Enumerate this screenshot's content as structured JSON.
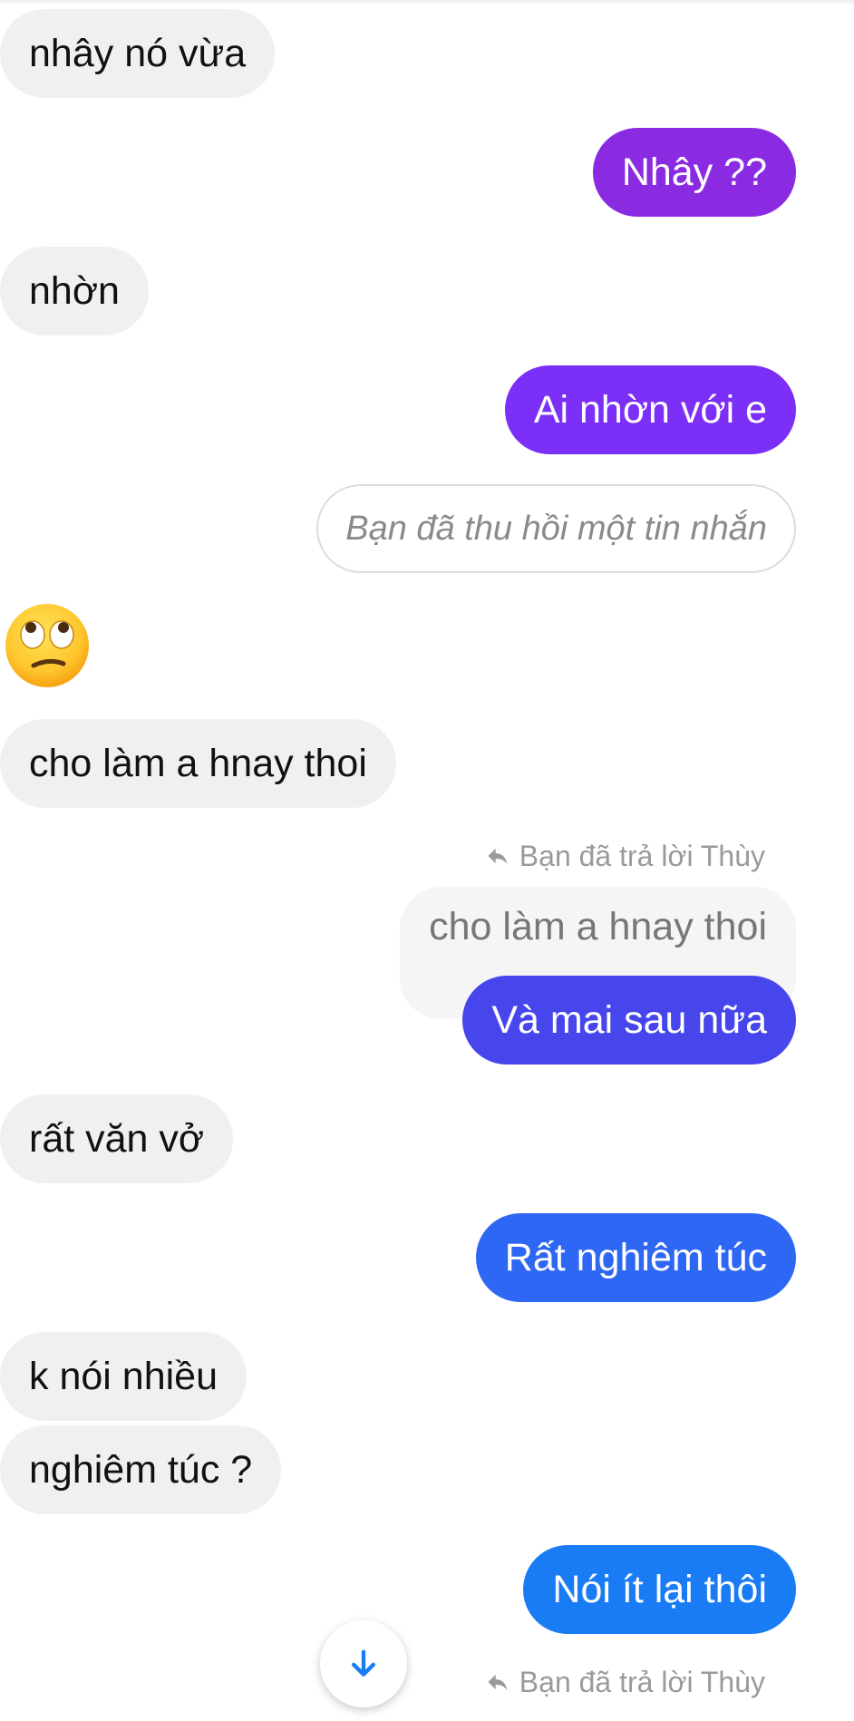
{
  "messages": {
    "m1": "nhây nó vừa",
    "m2": "Nhây ??",
    "m3": "nhờn",
    "m4": "Ai nhờn với e",
    "m5_unsent": "Bạn đã thu hồi một tin nhắn",
    "m6_emoji": "face-with-rolling-eyes",
    "m7": "cho làm a hnay thoi",
    "m8_reply_label": "Bạn đã trả lời Thùy",
    "m8_quoted": "cho làm a hnay thoi",
    "m8": "Và mai sau nữa",
    "m9": "rất văn vở",
    "m10": "Rất nghiêm túc",
    "m11": "k nói nhiều",
    "m12": "nghiêm túc ?",
    "m13": "Nói ít lại thôi",
    "m14_reply_label": "Bạn đã trả lời Thùy"
  },
  "icons": {
    "reply": "reply-arrow-icon",
    "scroll": "arrow-down-icon"
  },
  "colors": {
    "received_bg": "#f0f0f0",
    "sent_purple": "#8a2be2",
    "sent_violet": "#7b2ff7",
    "sent_indigo": "#4646ec",
    "sent_blue": "#2f67f5",
    "sent_azure": "#1a7cf5"
  }
}
